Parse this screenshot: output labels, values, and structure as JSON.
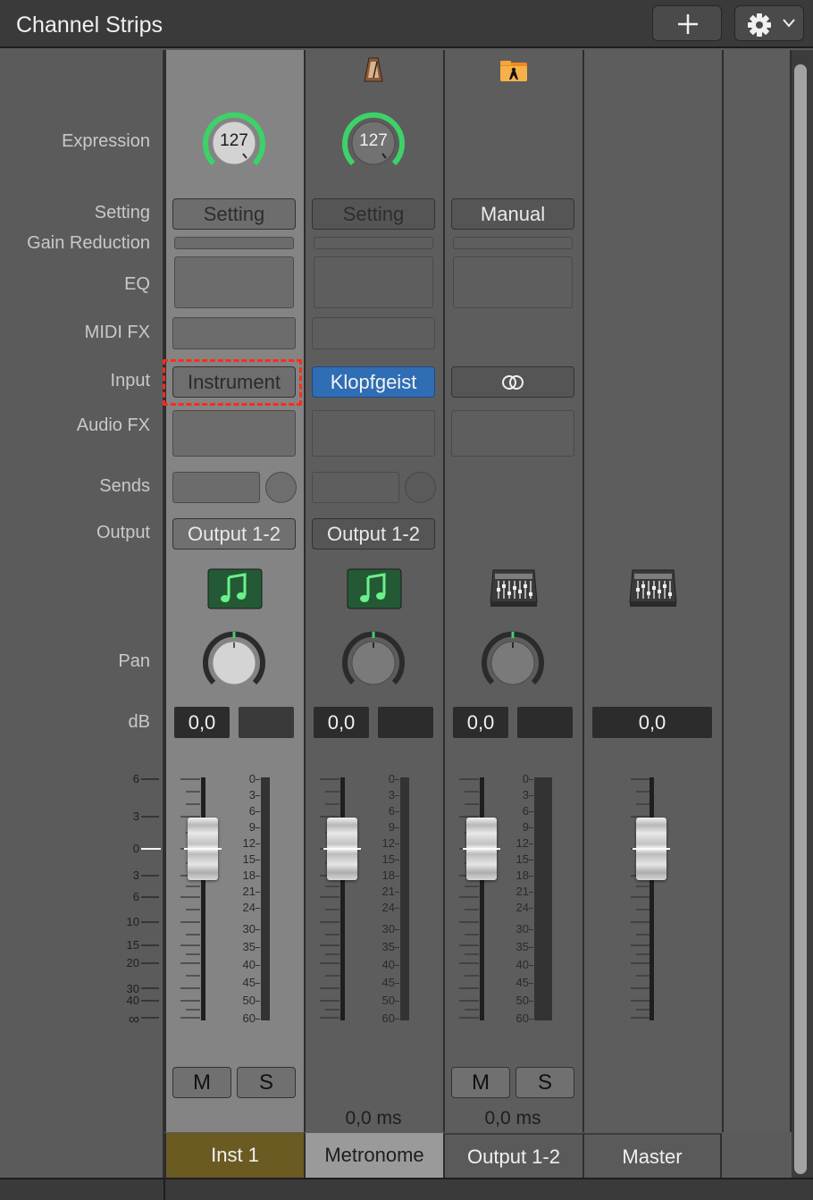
{
  "header": {
    "title": "Channel Strips",
    "add_icon": "plus-icon",
    "settings_icon": "gear-icon"
  },
  "row_labels": {
    "expression": "Expression",
    "setting": "Setting",
    "gain_reduction": "Gain Reduction",
    "eq": "EQ",
    "midi_fx": "MIDI FX",
    "input": "Input",
    "audio_fx": "Audio FX",
    "sends": "Sends",
    "output": "Output",
    "pan": "Pan",
    "db": "dB"
  },
  "fader_scale": [
    "6",
    "3",
    "0",
    "3",
    "6",
    "10",
    "15",
    "20",
    "30",
    "40",
    "∞"
  ],
  "meter_scale": [
    "0",
    "3",
    "6",
    "9",
    "12",
    "15",
    "18",
    "21",
    "24",
    "30",
    "35",
    "40",
    "45",
    "50",
    "60"
  ],
  "strips": [
    {
      "name": "Inst 1",
      "expression": "127",
      "setting": "Setting",
      "input": "Instrument",
      "output": "Output 1-2",
      "pan_db": "0,0",
      "mute": "M",
      "solo": "S",
      "track_icon": "music-note-icon"
    },
    {
      "name": "Metronome",
      "top_icon": "metronome-icon",
      "expression": "127",
      "setting": "Setting",
      "input": "Klopfgeist",
      "output": "Output 1-2",
      "pan_db": "0,0",
      "delay": "0,0 ms",
      "track_icon": "music-note-icon"
    },
    {
      "name": "Output 1-2",
      "top_icon": "folder-performer-icon",
      "setting": "Manual",
      "input_icon": "stereo-link-icon",
      "pan_db": "0,0",
      "mute": "M",
      "solo": "S",
      "delay": "0,0 ms",
      "track_icon": "mixer-icon"
    },
    {
      "name": "Master",
      "db": "0,0",
      "track_icon": "mixer-icon"
    }
  ],
  "colors": {
    "selected_strip_name": "#6b5a22",
    "knob_ring": "#3ed16a",
    "plugin_blue": "#2f6db5",
    "highlight_outline": "#ff2a1a"
  }
}
